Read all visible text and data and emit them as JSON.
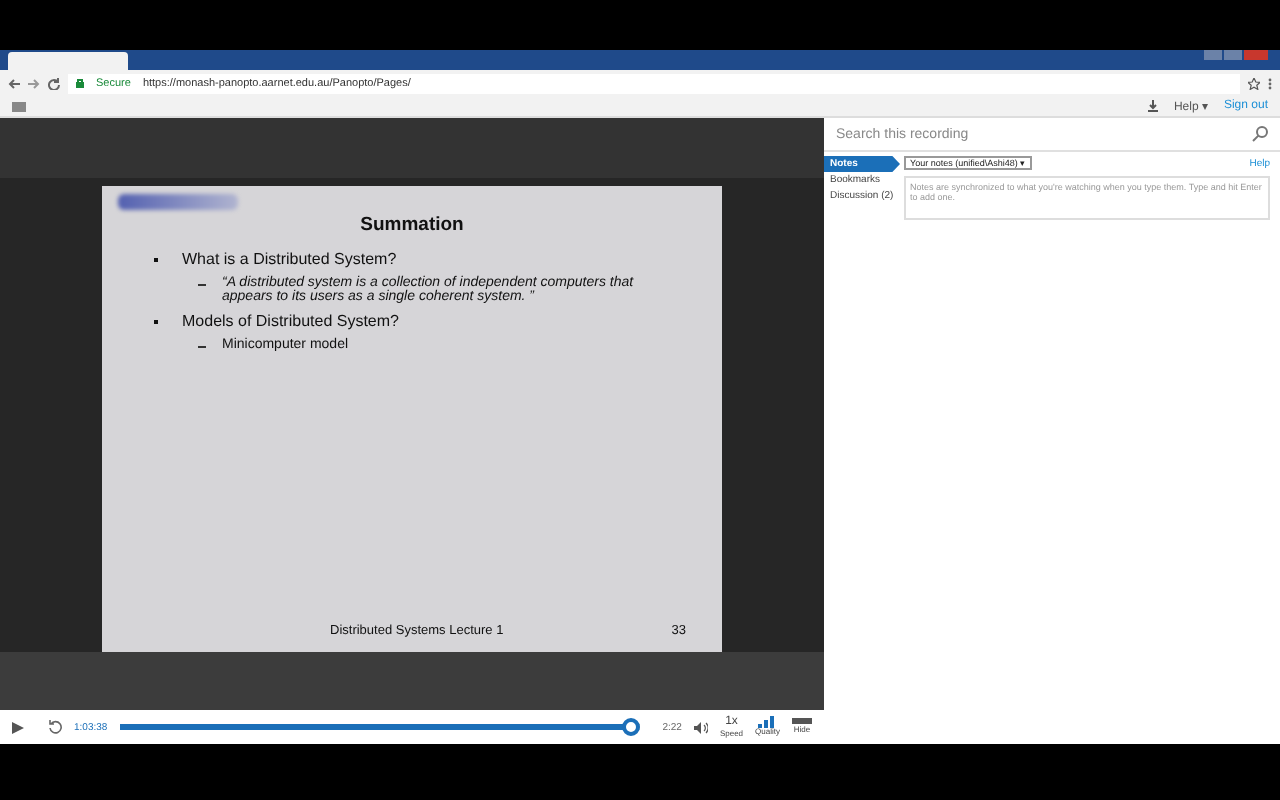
{
  "browser": {
    "secure_label": "Secure",
    "url": "https://monash-panopto.aarnet.edu.au/Panopto/Pages/"
  },
  "header": {
    "help": "Help ▾",
    "sign_out": "Sign out"
  },
  "slide": {
    "title": "Summation",
    "bullets": [
      {
        "kind": "bullet",
        "text": "What is a Distributed System?"
      },
      {
        "kind": "quote",
        "text": "“A distributed system is a collection of independent computers that appears to its users as a single coherent system. ”"
      },
      {
        "kind": "bullet",
        "text": "Models of Distributed System?"
      },
      {
        "kind": "sub",
        "text": "Minicomputer model"
      }
    ],
    "footer": "Distributed Systems Lecture 1",
    "page": "33"
  },
  "player": {
    "elapsed": "1:03:38",
    "remaining": "2:22",
    "level": 0.985,
    "speed_value": "1x",
    "speed_label": "Speed",
    "quality_label": "Quality",
    "hide_label": "Hide"
  },
  "sidebar": {
    "search": {
      "placeholder": "Search this recording"
    },
    "tabs": [
      {
        "label": "Notes",
        "selected": true
      },
      {
        "label": "Bookmarks",
        "selected": false
      },
      {
        "label": "Discussion (2)",
        "selected": false
      }
    ],
    "notes_select": "Your notes (unified\\Ashi48) ▾",
    "help": "Help",
    "notes_placeholder": "Notes are synchronized to what you're watching when you type them. Type and hit Enter to add one."
  }
}
